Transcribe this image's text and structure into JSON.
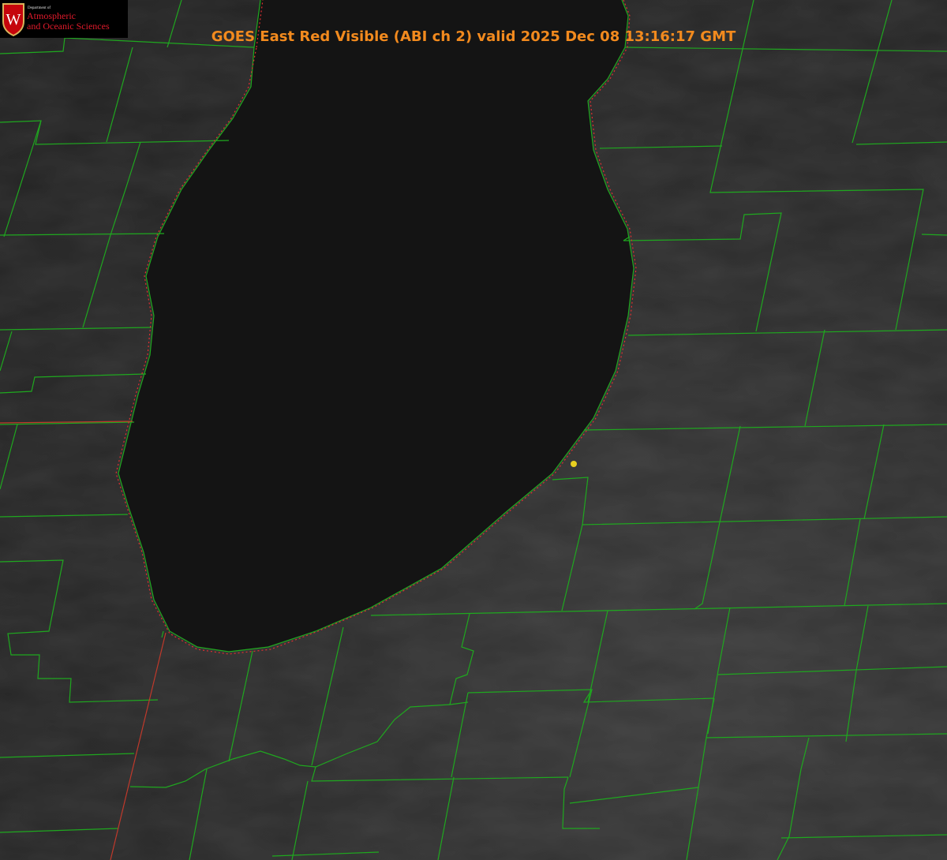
{
  "title": "GOES East Red Visible (ABI ch 2) valid 2025 Dec 08 13:16:17 GMT",
  "logo": {
    "department_label": "Department of",
    "name_line1": "Atmospheric",
    "name_line2": "and Oceanic Sciences",
    "crest_letter": "W"
  },
  "colors": {
    "county_borders": "#1fa81f",
    "state_border": "#c0392b",
    "shoreline": "#e03030",
    "title_text": "#f28a1e",
    "marker": "#e8d020"
  }
}
